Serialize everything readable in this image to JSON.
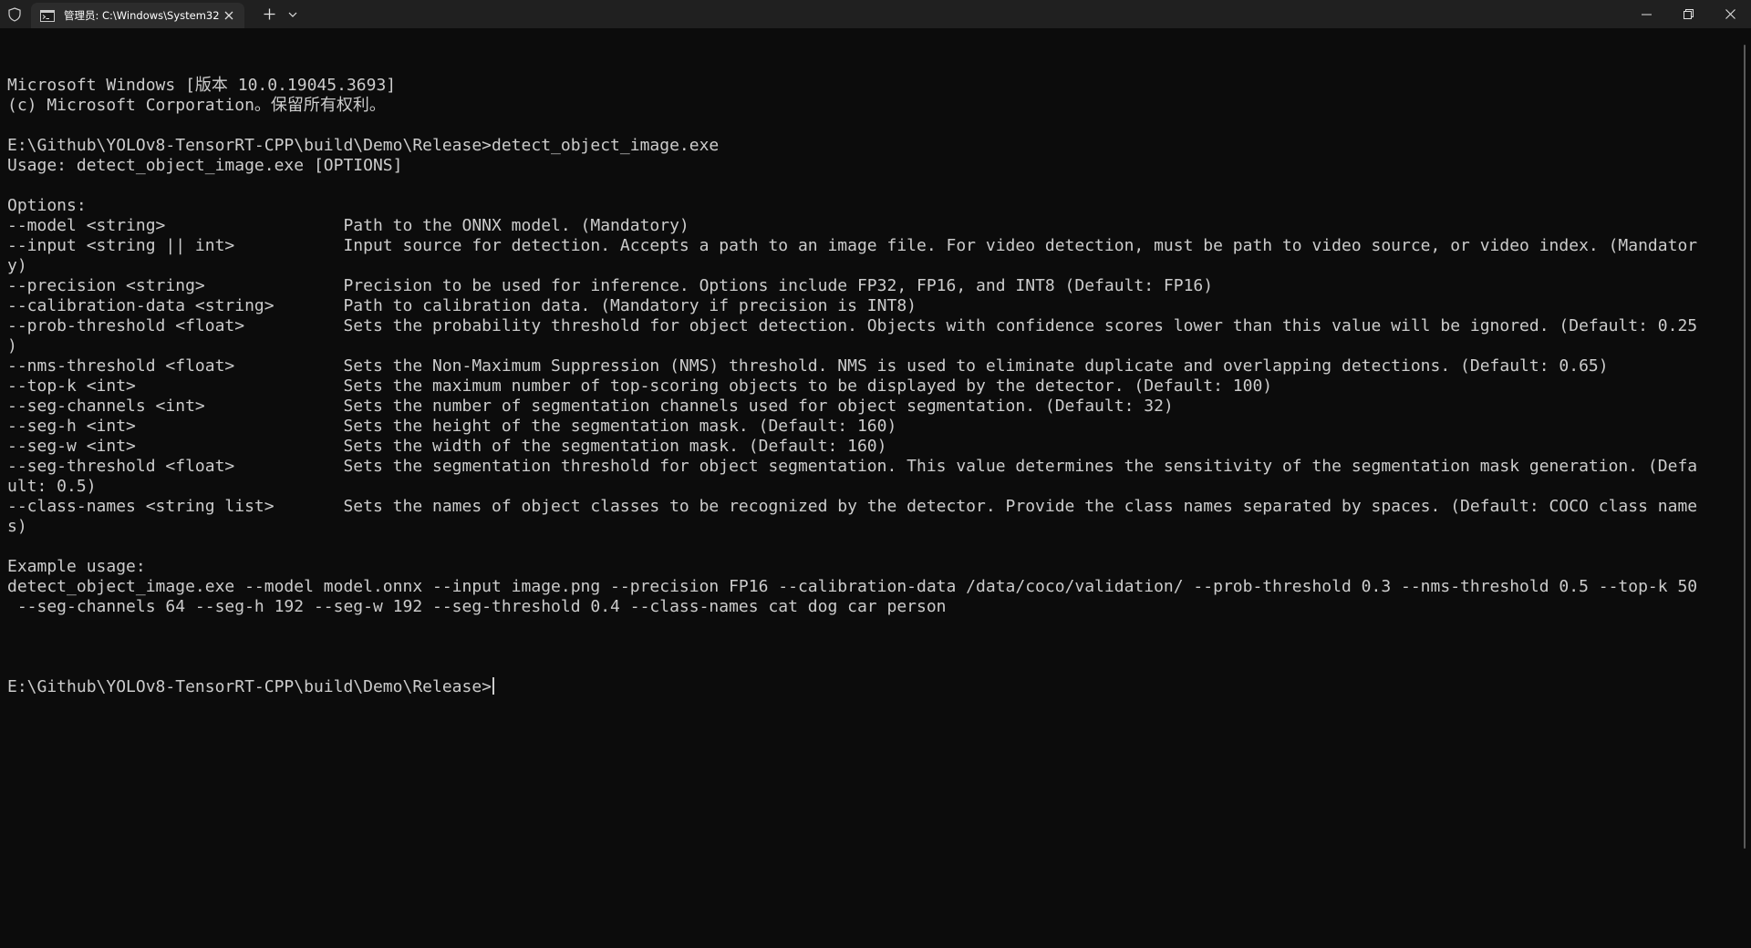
{
  "tab": {
    "title": "管理员: C:\\Windows\\System32"
  },
  "icons": {
    "shield": "shield-icon",
    "tab": "cmd-icon",
    "close": "close-icon",
    "new_tab": "plus-icon",
    "dropdown": "chevron-down-icon",
    "minimize": "minimize-icon",
    "maximize": "restore-icon",
    "window_close": "window-close-icon"
  },
  "colors": {
    "background": "#0c0c0c",
    "titlebar": "#202020",
    "tab": "#2c2c2c",
    "text": "#cccccc"
  },
  "console": {
    "lines": [
      "Microsoft Windows [版本 10.0.19045.3693]",
      "(c) Microsoft Corporation。保留所有权利。",
      "",
      "E:\\Github\\YOLOv8-TensorRT-CPP\\build\\Demo\\Release>detect_object_image.exe",
      "Usage: detect_object_image.exe [OPTIONS]",
      "",
      "Options:",
      "--model <string>                  Path to the ONNX model. (Mandatory)",
      "--input <string || int>           Input source for detection. Accepts a path to an image file. For video detection, must be path to video source, or video index. (Mandator",
      "y)",
      "--precision <string>              Precision to be used for inference. Options include FP32, FP16, and INT8 (Default: FP16)",
      "--calibration-data <string>       Path to calibration data. (Mandatory if precision is INT8)",
      "--prob-threshold <float>          Sets the probability threshold for object detection. Objects with confidence scores lower than this value will be ignored. (Default: 0.25",
      ")",
      "--nms-threshold <float>           Sets the Non-Maximum Suppression (NMS) threshold. NMS is used to eliminate duplicate and overlapping detections. (Default: 0.65)",
      "--top-k <int>                     Sets the maximum number of top-scoring objects to be displayed by the detector. (Default: 100)",
      "--seg-channels <int>              Sets the number of segmentation channels used for object segmentation. (Default: 32)",
      "--seg-h <int>                     Sets the height of the segmentation mask. (Default: 160)",
      "--seg-w <int>                     Sets the width of the segmentation mask. (Default: 160)",
      "--seg-threshold <float>           Sets the segmentation threshold for object segmentation. This value determines the sensitivity of the segmentation mask generation. (Defa",
      "ult: 0.5)",
      "--class-names <string list>       Sets the names of object classes to be recognized by the detector. Provide the class names separated by spaces. (Default: COCO class name",
      "s)",
      "",
      "Example usage:",
      "detect_object_image.exe --model model.onnx --input image.png --precision FP16 --calibration-data /data/coco/validation/ --prob-threshold 0.3 --nms-threshold 0.5 --top-k 50",
      " --seg-channels 64 --seg-h 192 --seg-w 192 --seg-threshold 0.4 --class-names cat dog car person",
      ""
    ],
    "prompt": "E:\\Github\\YOLOv8-TensorRT-CPP\\build\\Demo\\Release>"
  }
}
